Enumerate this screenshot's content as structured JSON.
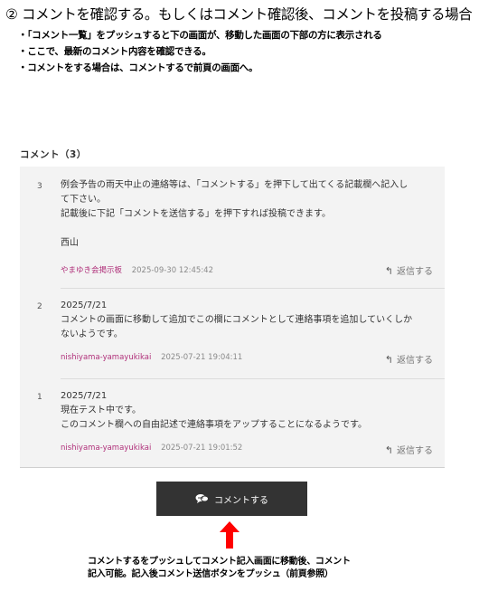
{
  "heading": "② コメントを確認する。もしくはコメント確認後、コメントを投稿する場合",
  "bullets": [
    "・「コメント一覧」をプッシュすると下の画面が、移動した画面の下部の方に表示される",
    "・ここで、最新のコメント内容を確認できる。",
    "・コメントをする場合は、コメントするで前頁の画面へ。"
  ],
  "comments_title": "コメント（3）",
  "comments": [
    {
      "number": "3",
      "lines": [
        "例会予告の雨天中止の連絡等は、「コメントする」を押下して出てくる記載欄へ記入し",
        "て下さい。",
        "記載後に下記「コメントを送信する」を押下すれば投稿できます。",
        "",
        "西山"
      ],
      "author": "やまゆき会掲示板",
      "date": "2025-09-30 12:45:42",
      "reply": "返信する"
    },
    {
      "number": "2",
      "lines": [
        "2025/7/21",
        "コメントの画面に移動して追加でこの欄にコメントとして連絡事項を追加していくしか",
        "ないようです。"
      ],
      "author": "nishiyama-yamayukikai",
      "date": "2025-07-21 19:04:11",
      "reply": "返信する"
    },
    {
      "number": "1",
      "lines": [
        "2025/7/21",
        "現在テスト中です。",
        "このコメント欄への自由記述で連絡事項をアップすることになるようです。"
      ],
      "author": "nishiyama-yamayukikai",
      "date": "2025-07-21 19:01:52",
      "reply": "返信する"
    }
  ],
  "comment_button": "コメントする",
  "note": [
    "コメントするをプッシュしてコメント記入画面に移動後、コメント",
    "記入可能。記入後コメント送信ボタンをプッシュ（前頁参照）"
  ],
  "colors": {
    "button": "#333333",
    "arrow": "#ff0000",
    "author": "#b0307a",
    "panel": "#f3f3f3"
  },
  "icons": {
    "reply": "reply-arrow-icon",
    "comment": "speech-bubble-icon"
  }
}
